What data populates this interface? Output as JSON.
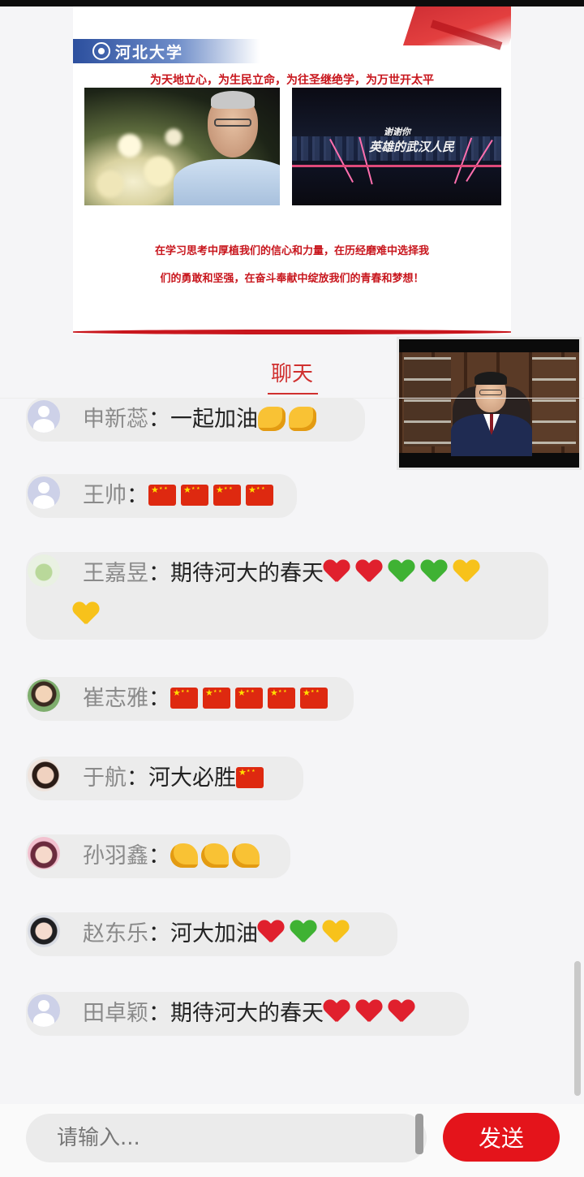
{
  "slide": {
    "logo_text": "河北大学",
    "motto": "为天地立心，为生民立命，为往圣继绝学，为万世开太平",
    "bridge_caption_small": "谢谢你",
    "bridge_caption": "英雄的武汉人民",
    "line1": "在学习思考中厚植我们的信心和力量，在历经磨难中选择我",
    "line2": "们的勇敢和坚强，在奋斗奉献中绽放我们的青春和梦想！"
  },
  "chat": {
    "tab_label": "聊天",
    "colon": "：",
    "messages": [
      {
        "name": "申新蕊",
        "text": "一起加油",
        "emojis": [
          "fist",
          "fist"
        ],
        "avatar": "default"
      },
      {
        "name": "王帅",
        "text": "",
        "emojis": [
          "flag-cn",
          "flag-cn",
          "flag-cn",
          "flag-cn"
        ],
        "avatar": "default"
      },
      {
        "name": "王嘉昱",
        "text": "期待河大的春天",
        "emojis": [
          "red-heart",
          "red-heart",
          "green-heart",
          "green-heart",
          "yellow-heart",
          "yellow-heart"
        ],
        "avatar": "plant"
      },
      {
        "name": "崔志雅",
        "text": "",
        "emojis": [
          "flag-cn",
          "flag-cn",
          "flag-cn",
          "flag-cn",
          "flag-cn"
        ],
        "avatar": "photo"
      },
      {
        "name": "于航",
        "text": "河大必胜",
        "emojis": [
          "flag-cn"
        ],
        "avatar": "photo"
      },
      {
        "name": "孙羽鑫",
        "text": "",
        "emojis": [
          "flexed-biceps",
          "flexed-biceps",
          "flexed-biceps"
        ],
        "avatar": "photo"
      },
      {
        "name": "赵东乐",
        "text": "河大加油",
        "emojis": [
          "red-heart",
          "green-heart",
          "yellow-heart"
        ],
        "avatar": "photo"
      },
      {
        "name": "田卓颖",
        "text": "期待河大的春天",
        "emojis": [
          "red-heart",
          "red-heart",
          "red-heart"
        ],
        "avatar": "default"
      }
    ]
  },
  "input": {
    "placeholder": "请输入...",
    "send_label": "发送"
  },
  "colors": {
    "accent": "#e4141b",
    "slide_red": "#c8161d",
    "tab_red": "#d0302f",
    "bubble_bg": "#ececec",
    "username_gray": "#8a8a8a"
  }
}
